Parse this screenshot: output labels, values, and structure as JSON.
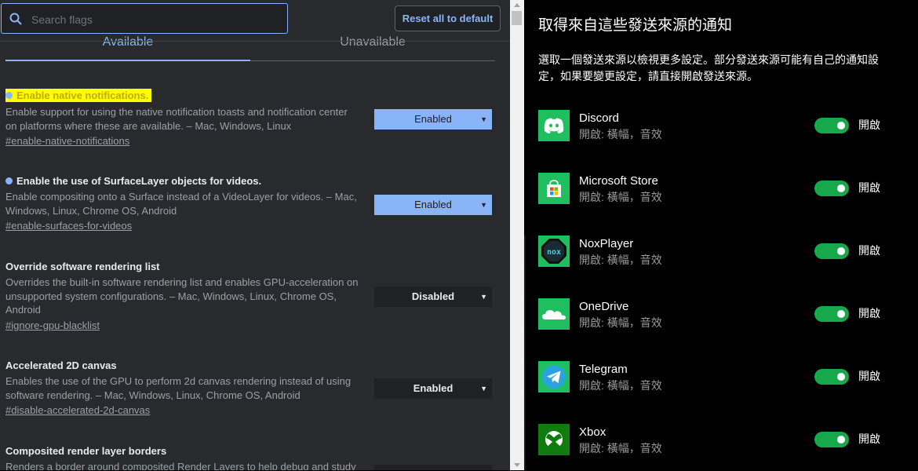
{
  "flags_page": {
    "search": {
      "placeholder": "Search flags",
      "value": ""
    },
    "reset_label": "Reset all to default",
    "tabs": [
      {
        "label": "Available",
        "active": true
      },
      {
        "label": "Unavailable",
        "active": false
      }
    ],
    "flags": [
      {
        "title": "Enable native notifications.",
        "highlighted": true,
        "modified": true,
        "description": "Enable support for using the native notification toasts and notification center on platforms where these are available. – Mac, Windows, Linux",
        "link": "#enable-native-notifications",
        "selected": "Enabled"
      },
      {
        "title": "Enable the use of SurfaceLayer objects for videos.",
        "highlighted": false,
        "modified": true,
        "description": "Enable compositing onto a Surface instead of a VideoLayer for videos. – Mac, Windows, Linux, Chrome OS, Android",
        "link": "#enable-surfaces-for-videos",
        "selected": "Enabled"
      },
      {
        "title": "Override software rendering list",
        "highlighted": false,
        "modified": false,
        "description": "Overrides the built-in software rendering list and enables GPU-acceleration on unsupported system configurations. – Mac, Windows, Linux, Chrome OS, Android",
        "link": "#ignore-gpu-blacklist",
        "selected": "Disabled"
      },
      {
        "title": "Accelerated 2D canvas",
        "highlighted": false,
        "modified": false,
        "description": "Enables the use of the GPU to perform 2d canvas rendering instead of using software rendering. – Mac, Windows, Linux, Chrome OS, Android",
        "link": "#disable-accelerated-2d-canvas",
        "selected": "Enabled"
      },
      {
        "title": "Composited render layer borders",
        "highlighted": false,
        "modified": false,
        "description": "Renders a border around composited Render Layers to help debug and study",
        "link": "",
        "selected": ""
      }
    ]
  },
  "notifications_page": {
    "title": "取得來自這些發送來源的通知",
    "description": "選取一個發送來源以檢視更多設定。部分發送來源可能有自己的通知設定，如果要變更設定，請直接開啟發送來源。",
    "senders": [
      {
        "name": "Discord",
        "detail": "開啟: 橫幅，音效",
        "toggle_label": "開啟",
        "icon": "discord-icon",
        "icon_bg": "#1fbf5f"
      },
      {
        "name": "Microsoft Store",
        "detail": "開啟: 橫幅，音效",
        "toggle_label": "開啟",
        "icon": "microsoft-store-icon",
        "icon_bg": "#1fbf5f"
      },
      {
        "name": "NoxPlayer",
        "detail": "開啟: 橫幅，音效",
        "toggle_label": "開啟",
        "icon": "noxplayer-icon",
        "icon_bg": "#1fbf5f"
      },
      {
        "name": "OneDrive",
        "detail": "開啟: 橫幅，音效",
        "toggle_label": "開啟",
        "icon": "onedrive-icon",
        "icon_bg": "#1fbf5f"
      },
      {
        "name": "Telegram",
        "detail": "開啟: 橫幅，音效",
        "toggle_label": "開啟",
        "icon": "telegram-icon",
        "icon_bg": "#1fbf5f"
      },
      {
        "name": "Xbox",
        "detail": "開啟: 橫幅，音效",
        "toggle_label": "開啟",
        "icon": "xbox-icon",
        "icon_bg": "#107c10"
      }
    ]
  },
  "colors": {
    "flags_bg": "#292a2d",
    "accent_blue": "#8ab4f8",
    "toggle_on": "#17a84c",
    "highlight": "#ffff00"
  }
}
